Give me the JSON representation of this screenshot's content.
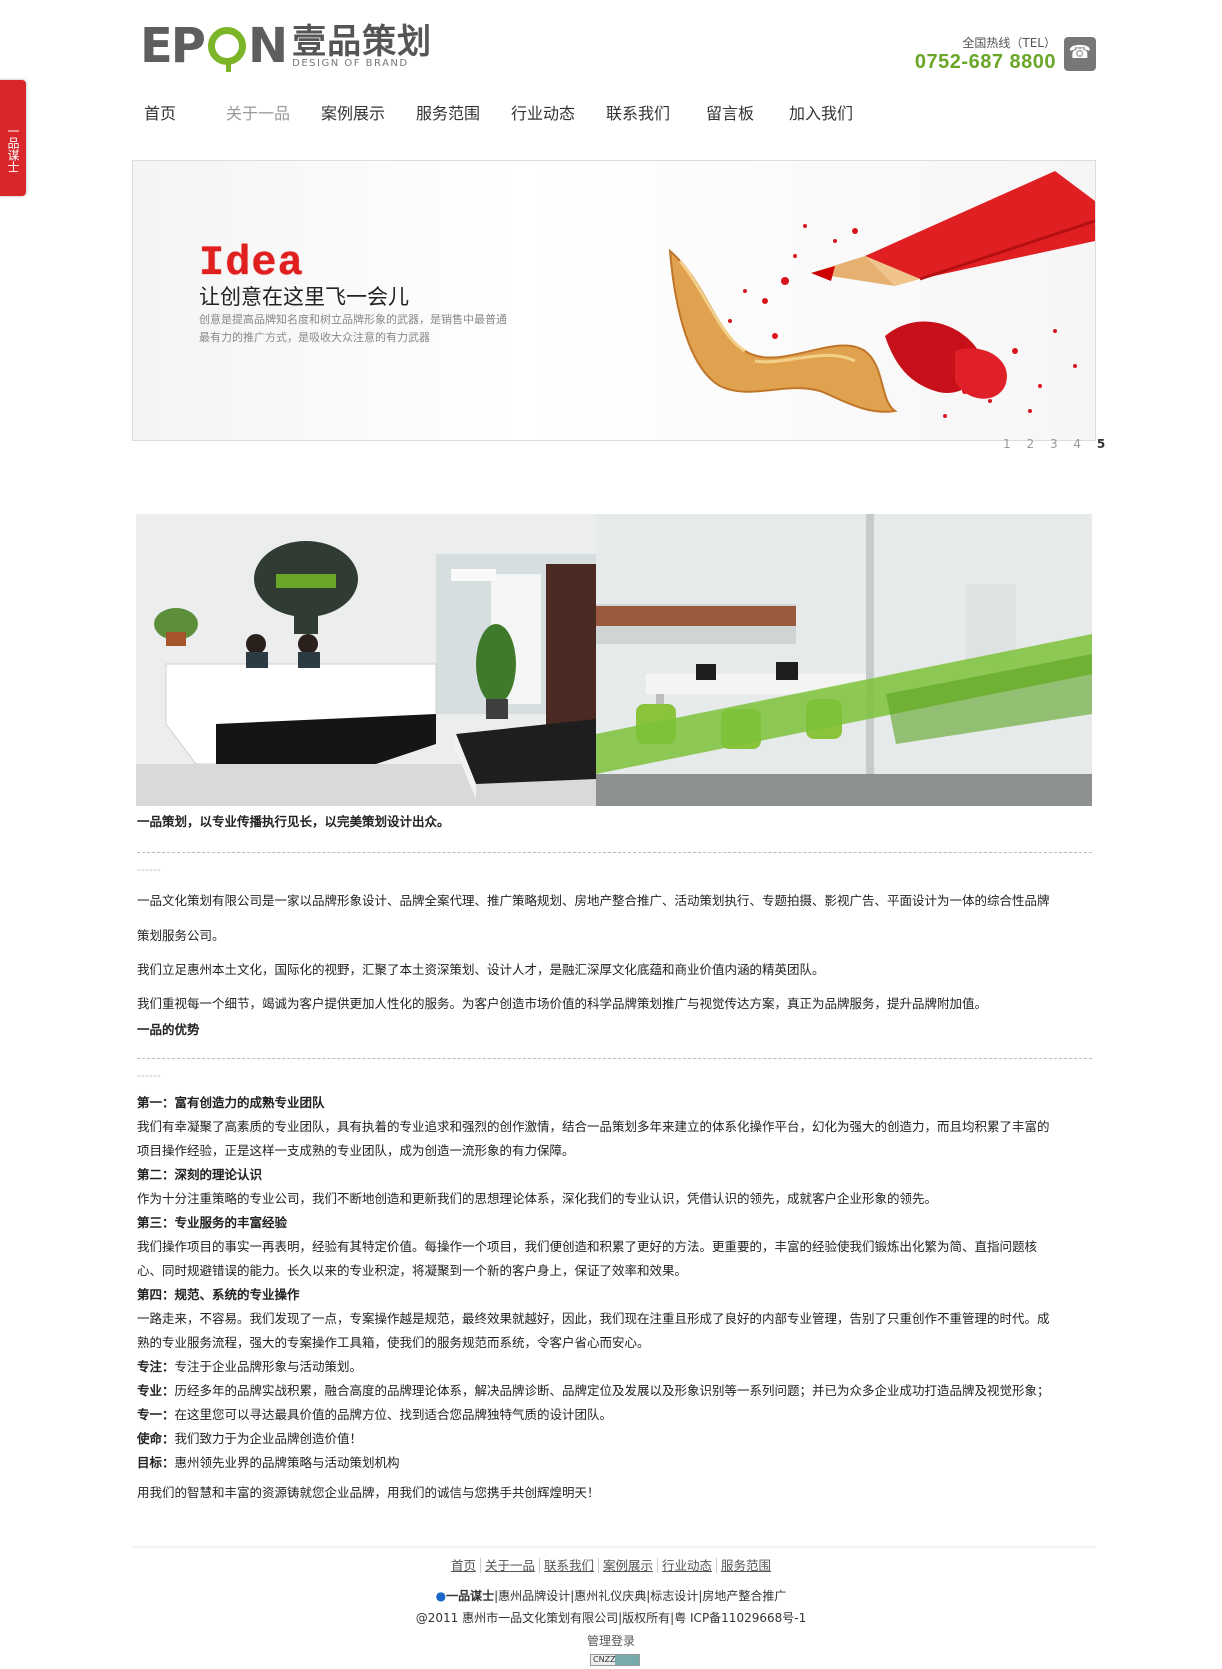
{
  "side_tab": {
    "label": "一品谋士"
  },
  "header": {
    "logo_latin": [
      "E",
      "P",
      "",
      "N"
    ],
    "logo_cn": "壹品策划",
    "logo_en": "DESIGN OF BRAND",
    "hotline_label": "全国热线（TEL）",
    "hotline_number": "0752-687 8800"
  },
  "nav": [
    {
      "label": "首页",
      "active": false
    },
    {
      "label": "关于一品",
      "active": true
    },
    {
      "label": "案例展示",
      "active": false
    },
    {
      "label": "服务范围",
      "active": false
    },
    {
      "label": "行业动态",
      "active": false
    },
    {
      "label": "联系我们",
      "active": false
    },
    {
      "label": "留言板",
      "active": false
    },
    {
      "label": "加入我们",
      "active": false
    }
  ],
  "banner": {
    "headline": "Idea",
    "subtitle": "让创意在这里飞一会儿",
    "desc_line1": "创意是提高品牌知名度和树立品牌形象的武器，是销售中最普通",
    "desc_line2": "最有力的推广方式，是吸收大众注意的有力武器",
    "pages": [
      "1",
      "2",
      "3",
      "4",
      "5"
    ],
    "current_page": "5"
  },
  "content": {
    "tagline": "一品策划，以专业传播执行见长，以完美策划设计出众。",
    "dash": "------",
    "intro_1": "一品文化策划有限公司是一家以品牌形象设计、品牌全案代理、推广策略规划、房地产整合推广、活动策划执行、专题拍摄、影视广告、平面设计为一体的综合性品牌",
    "intro_1b": "策划服务公司。",
    "intro_2": "我们立足惠州本土文化，国际化的视野，汇聚了本土资深策划、设计人才，是融汇深厚文化底蕴和商业价值内涵的精英团队。",
    "intro_3": "我们重视每一个细节，竭诚为客户提供更加人性化的服务。为客户创造市场价值的科学品牌策划推广与视觉传达方案，真正为品牌服务，提升品牌附加值。",
    "adv_title": "一品的优势",
    "p1_title": "第一：富有创造力的成熟专业团队",
    "p1_text_a": "我们有幸凝聚了高素质的专业团队，具有执着的专业追求和强烈的创作激情，结合一品策划多年来建立的体系化操作平台，幻化为强大的创造力，而且均积累了丰富的",
    "p1_text_b": "项目操作经验，正是这样一支成熟的专业团队，成为创造一流形象的有力保障。",
    "p2_title": "第二：深刻的理论认识",
    "p2_text": "作为十分注重策略的专业公司，我们不断地创造和更新我们的思想理论体系，深化我们的专业认识，凭借认识的领先，成就客户企业形象的领先。",
    "p3_title": "第三：专业服务的丰富经验",
    "p3_text_a": "我们操作项目的事实一再表明，经验有其特定价值。每操作一个项目，我们便创造和积累了更好的方法。更重要的，丰富的经验使我们锻炼出化繁为简、直指问题核",
    "p3_text_b": "心、同时规避错误的能力。长久以来的专业积淀，将凝聚到一个新的客户身上，保证了效率和效果。",
    "p4_title": "第四：规范、系统的专业操作",
    "p4_text_a": "一路走来，不容易。我们发现了一点，专案操作越是规范，最终效果就越好，因此，我们现在注重且形成了良好的内部专业管理，告别了只重创作不重管理的时代。成",
    "p4_text_b": "熟的专业服务流程，强大的专案操作工具箱，使我们的服务规范而系统，令客户省心而安心。",
    "focus_label": "专注：",
    "focus_text": "专注于企业品牌形象与活动策划。",
    "pro_label": "专业：",
    "pro_text": "历经多年的品牌实战积累，融合高度的品牌理论体系，解决品牌诊断、品牌定位及发展以及形象识别等一系列问题；并已为众多企业成功打造品牌及视觉形象；",
    "one_label": "专一：",
    "one_text": "在这里您可以寻达最具价值的品牌方位、找到适合您品牌独特气质的设计团队。",
    "mission_label": "使命：",
    "mission_text": "我们致力于为企业品牌创造价值！",
    "goal_label": "目标：",
    "goal_text": "惠州领先业界的品牌策略与活动策划机构",
    "closing": "用我们的智慧和丰富的资源铸就您企业品牌，用我们的诚信与您携手共创辉煌明天！"
  },
  "footer": {
    "nav": [
      "首页",
      "关于一品",
      "联系我们",
      "案例展示",
      "行业动态",
      "服务范围"
    ],
    "qq_label": "一品谋士",
    "links": [
      "惠州品牌设计",
      "惠州礼仪庆典",
      "标志设计",
      "房地产整合推广"
    ],
    "copyright": "@2011 惠州市一品文化策划有限公司|版权所有|粤 ICP备11029668号-1",
    "admin": "管理登录",
    "badge": "CNZZ"
  },
  "colors": {
    "accent_green": "#6aa728",
    "accent_red": "#d8262a",
    "logo_gray": "#5e5e5e"
  }
}
